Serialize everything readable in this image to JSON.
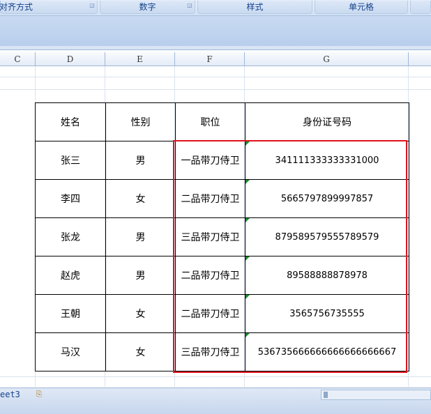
{
  "ribbon": {
    "groups": [
      {
        "label": "对齐方式"
      },
      {
        "label": "数字"
      },
      {
        "label": "样式"
      },
      {
        "label": "单元格"
      }
    ]
  },
  "columns": [
    "C",
    "D",
    "E",
    "F",
    "G"
  ],
  "table": {
    "headers": [
      "姓名",
      "性别",
      "职位",
      "身份证号码"
    ],
    "rows": [
      [
        "张三",
        "男",
        "一品带刀侍卫",
        "341111333333331000"
      ],
      [
        "李四",
        "女",
        "二品带刀侍卫",
        "5665797899997857"
      ],
      [
        "张龙",
        "男",
        "三品带刀侍卫",
        "879589579555789579"
      ],
      [
        "赵虎",
        "男",
        "二品带刀侍卫",
        "89588888878978"
      ],
      [
        "王朝",
        "女",
        "二品带刀侍卫",
        "3565756735555"
      ],
      [
        "马汉",
        "女",
        "三品带刀侍卫",
        "536735666666666666666667"
      ]
    ]
  },
  "highlight_color": "#e0131b",
  "sheet_tab": {
    "label": "eet3"
  },
  "icons": {
    "new_sheet": "insert-sheet-icon",
    "launcher": "dialog-launcher-icon"
  }
}
